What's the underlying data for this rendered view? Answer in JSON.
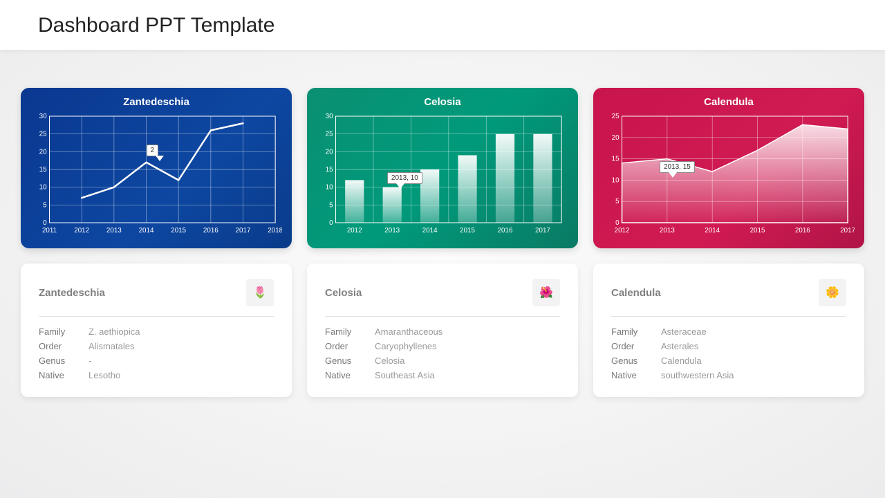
{
  "page_title": "Dashboard PPT Template",
  "cards": [
    {
      "title": "Zantedeschia",
      "info": {
        "Family": "Z. aethiopica",
        "Order": "Alismatales",
        "Genus": "-",
        "Native": "Lesotho"
      },
      "thumb_emoji": "🌷"
    },
    {
      "title": "Celosia",
      "info": {
        "Family": "Amaranthaceous",
        "Order": "Caryophyllenes",
        "Genus": "Celosia",
        "Native": "Southeast Asia"
      },
      "thumb_emoji": "🌺"
    },
    {
      "title": "Calendula",
      "info": {
        "Family": "Asteraceae",
        "Order": "Asterales",
        "Genus": "Calendula",
        "Native": "southwestern Asia"
      },
      "thumb_emoji": "🌼"
    }
  ],
  "field_labels": [
    "Family",
    "Order",
    "Genus",
    "Native"
  ],
  "chart_data": [
    {
      "type": "line",
      "title": "Zantedeschia",
      "x": [
        2012,
        2013,
        2014,
        2015,
        2016,
        2017
      ],
      "values": [
        7,
        10,
        17,
        12,
        26,
        28
      ],
      "ylim": [
        0,
        30
      ],
      "ytick": 5,
      "xlim": [
        2011,
        2018
      ],
      "callout": {
        "label": "2",
        "at_x": 2014,
        "at_y": 20
      }
    },
    {
      "type": "bar",
      "title": "Celosia",
      "categories": [
        2012,
        2013,
        2014,
        2015,
        2016,
        2017
      ],
      "values": [
        12,
        10,
        15,
        19,
        25,
        25
      ],
      "ylim": [
        0,
        30
      ],
      "ytick": 5,
      "callout": {
        "label": "2013, 10",
        "at_cat": 2013,
        "at_y": 10
      }
    },
    {
      "type": "area",
      "title": "Calendula",
      "x": [
        2012,
        2013,
        2014,
        2015,
        2016,
        2017
      ],
      "values": [
        14,
        15,
        12,
        17,
        23,
        22
      ],
      "ylim": [
        0,
        25
      ],
      "ytick": 5,
      "callout": {
        "label": "2013, 15",
        "at_x": 2013,
        "at_y": 15
      }
    }
  ]
}
